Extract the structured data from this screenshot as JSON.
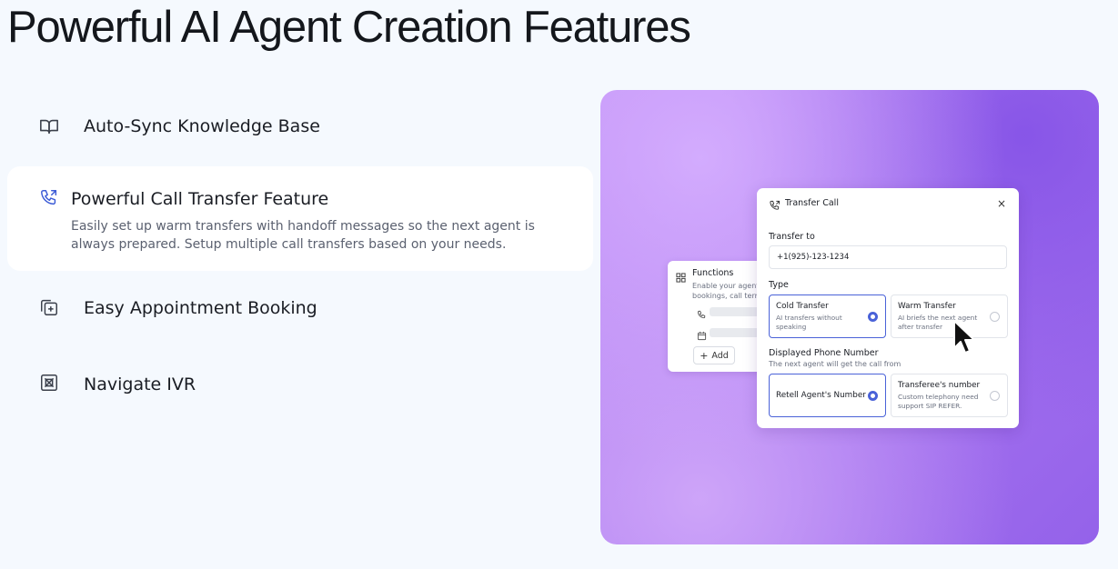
{
  "page": {
    "title": "Powerful AI Agent Creation Features"
  },
  "features": [
    {
      "label": "Auto-Sync Knowledge Base",
      "icon": "book-icon",
      "active": false
    },
    {
      "label": "Powerful Call Transfer Feature",
      "icon": "phone-transfer-icon",
      "active": true,
      "description": "Easily set up warm transfers with handoff messages so the next agent is always prepared. Setup multiple call transfers based on your needs."
    },
    {
      "label": "Easy Appointment Booking",
      "icon": "calendar-add-icon",
      "active": false
    },
    {
      "label": "Navigate IVR",
      "icon": "ivr-grid-icon",
      "active": false
    }
  ],
  "functions_card": {
    "title": "Functions",
    "description": "Enable your agent to bookings, call terminal",
    "add_label": "Add"
  },
  "transfer_card": {
    "title": "Transfer Call",
    "transfer_to_label": "Transfer to",
    "transfer_to_value": "+1(925)-123-1234",
    "type_label": "Type",
    "type_options": [
      {
        "title": "Cold Transfer",
        "description": "AI transfers without speaking",
        "selected": true
      },
      {
        "title": "Warm Transfer",
        "description": "AI briefs the next agent after transfer",
        "selected": false
      }
    ],
    "displayed_number_label": "Displayed Phone Number",
    "displayed_number_sublabel": "The next agent will get the call from",
    "number_options": [
      {
        "title": "Retell Agent's Number",
        "description": "",
        "selected": true
      },
      {
        "title": "Transferee's number",
        "description": "Custom telephony need support SIP REFER.",
        "selected": false
      }
    ]
  },
  "colors": {
    "background": "#f5f9fe",
    "active_row": "#ffffff",
    "radio_selected": "#4a62d8",
    "hero_gradient_start": "#c08df5",
    "hero_gradient_end": "#9462ea"
  }
}
